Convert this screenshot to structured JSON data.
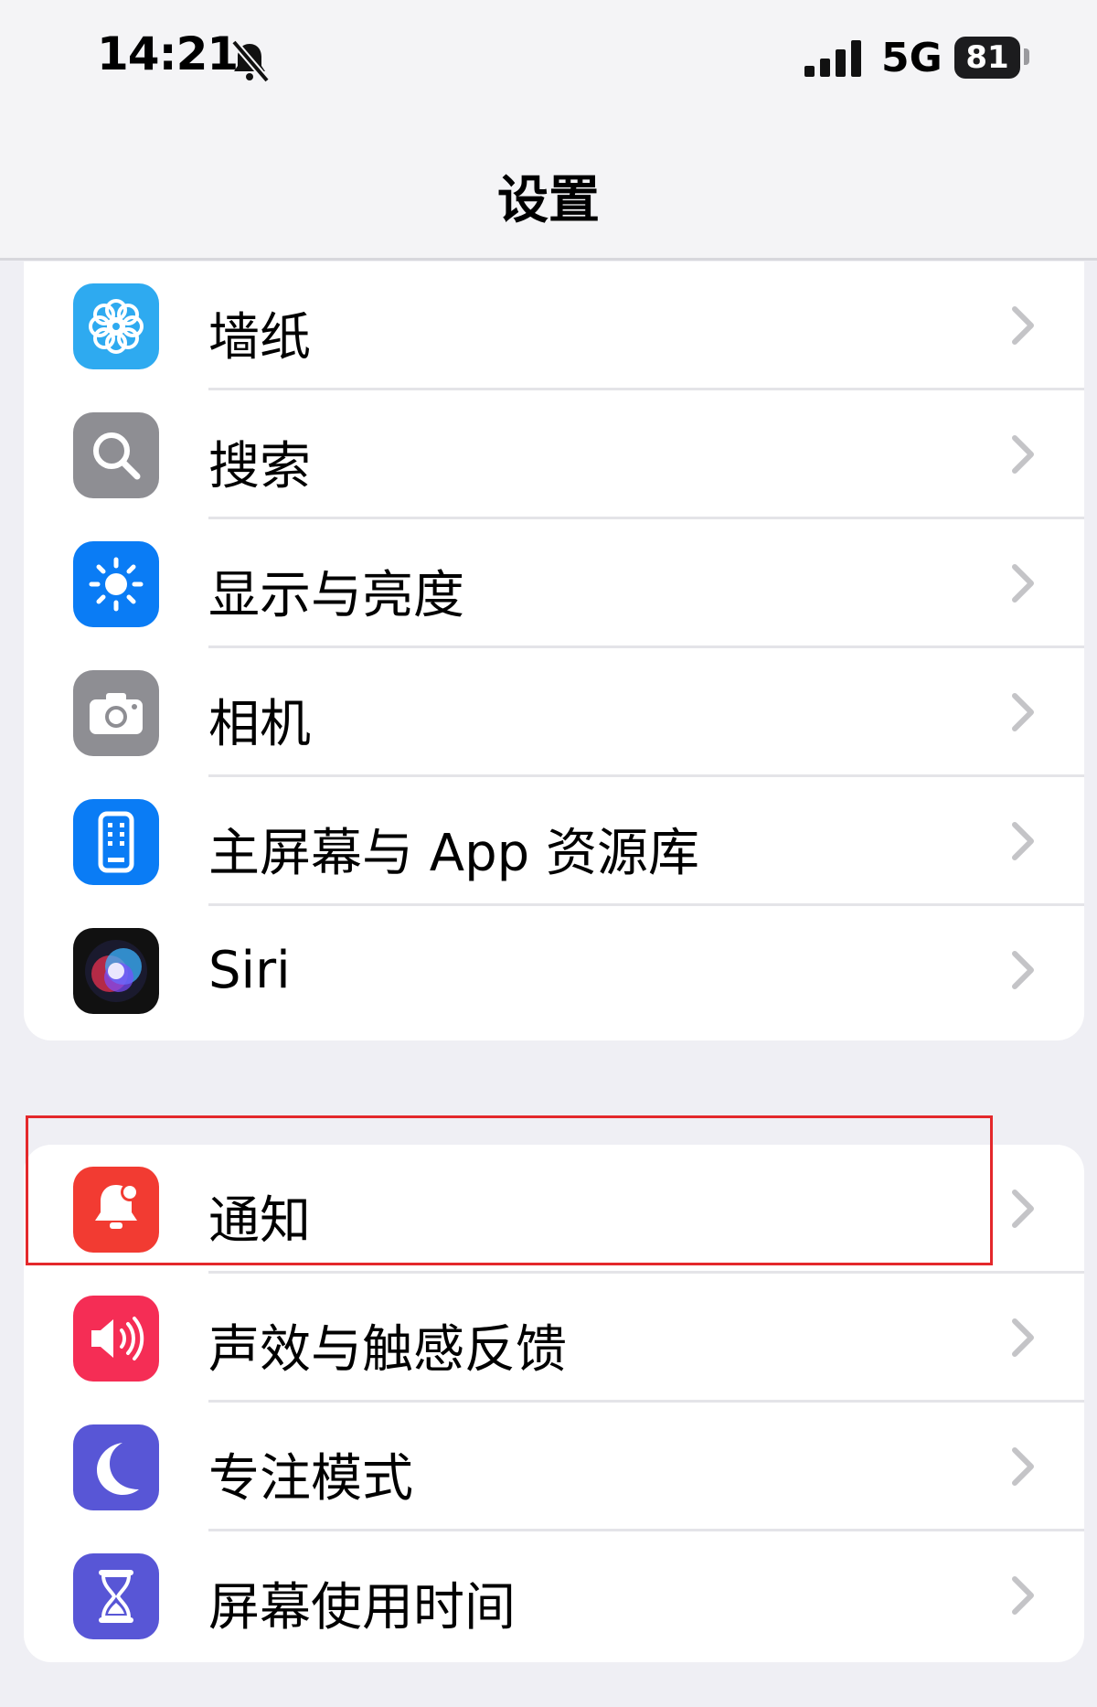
{
  "status_bar": {
    "time": "14:21",
    "network": "5G",
    "battery": "81",
    "silent_icon": "bell-slash-icon",
    "signal_icon": "signal-bars-icon"
  },
  "nav": {
    "title": "设置"
  },
  "groups": [
    {
      "items": [
        {
          "label": "墙纸",
          "icon": "wallpaper-flower-icon",
          "color": "#2eaaf0"
        },
        {
          "label": "搜索",
          "icon": "search-icon",
          "color": "#8e8e93"
        },
        {
          "label": "显示与亮度",
          "icon": "brightness-icon",
          "color": "#0a7cf5"
        },
        {
          "label": "相机",
          "icon": "camera-icon",
          "color": "#8e8e93"
        },
        {
          "label": "主屏幕与 App 资源库",
          "icon": "home-screen-icon",
          "color": "#0a7cf5"
        },
        {
          "label": "Siri",
          "icon": "siri-icon",
          "color": "#1a1a2e"
        }
      ]
    },
    {
      "items": [
        {
          "label": "通知",
          "icon": "notification-bell-icon",
          "color": "#f23b32",
          "highlighted": true
        },
        {
          "label": "声效与触感反馈",
          "icon": "speaker-icon",
          "color": "#f52d55"
        },
        {
          "label": "专注模式",
          "icon": "moon-icon",
          "color": "#5856d6"
        },
        {
          "label": "屏幕使用时间",
          "icon": "hourglass-icon",
          "color": "#5856d6"
        }
      ]
    }
  ],
  "colors": {
    "background": "#efeff4",
    "highlight_border": "#e4282b",
    "chevron": "#c4c4c7"
  }
}
